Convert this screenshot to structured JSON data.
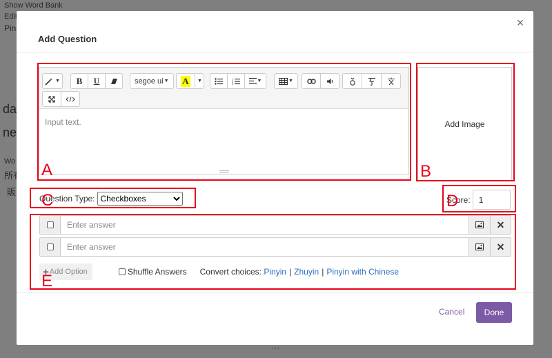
{
  "background": {
    "lines_top": [
      "Show Word Bank",
      "Edit",
      "Pin"
    ],
    "big_lines": [
      "da",
      "ne"
    ],
    "small_lines": [
      "Wo",
      "所有",
      "販"
    ],
    "bottom_text": "···"
  },
  "modal": {
    "title": "Add Question",
    "close_glyph": "×"
  },
  "editor": {
    "toolbar": {
      "font_name": "segoe ui",
      "highlight_letter": "A"
    },
    "placeholder": "Input text."
  },
  "add_image": {
    "label": "Add Image"
  },
  "question_type": {
    "label": "Question Type:",
    "selected": "Checkboxes"
  },
  "score": {
    "label": "Score:",
    "value": "1"
  },
  "answers": [
    {
      "placeholder": "Enter answer"
    },
    {
      "placeholder": "Enter answer"
    }
  ],
  "options": {
    "add_option": "Add Option",
    "shuffle": "Shuffle Answers",
    "convert_label": "Convert choices:",
    "pinyin": "Pinyin",
    "zhuyin": "Zhuyin",
    "pinyin_with_chinese": "Pinyin with Chinese",
    "separator": "|"
  },
  "footer": {
    "cancel": "Cancel",
    "done": "Done"
  },
  "annotations": {
    "a": "A",
    "b": "B",
    "c": "C",
    "d": "D",
    "e": "E"
  },
  "colors": {
    "accent": "#7b5aa6",
    "annotation": "#e8001c",
    "link": "#2a6ebb"
  }
}
